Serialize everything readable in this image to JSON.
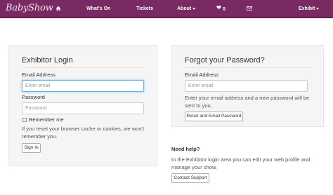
{
  "navbar": {
    "logo_text": "BabyShow",
    "items": [
      {
        "label": "",
        "icon": "home-icon"
      },
      {
        "label": "What's On"
      },
      {
        "label": "Tickets"
      },
      {
        "label": "About"
      },
      {
        "label": "0",
        "icon": "heart-icon"
      },
      {
        "label": "",
        "icon": "envelope-icon"
      },
      {
        "label": "Exhibit"
      }
    ],
    "colors": {
      "background": "#7a2a62",
      "text": "#ffffff"
    }
  },
  "login": {
    "title": "Exhibitor Login",
    "email_label": "Email Address",
    "email_placeholder": "Enter email",
    "email_value": "",
    "password_label": "Password",
    "password_placeholder": "Password",
    "password_value": "",
    "remember_label": "Remember me",
    "remember_checked": false,
    "cache_note": "If you reset your browser cache or cookies, we won't remember you.",
    "signin_label": "Sign In"
  },
  "forgot": {
    "title": "Forgot your Password?",
    "email_label": "Email Address",
    "email_placeholder": "Enter email",
    "email_value": "",
    "note": "Enter your email address and a new password will be sent to you.",
    "reset_label": "Reset and Email Password"
  },
  "help": {
    "heading": "Need help?",
    "text": "In the Exhibitor login area you can edit your web profile and manage your show.",
    "contact_label": "Contact Support"
  }
}
